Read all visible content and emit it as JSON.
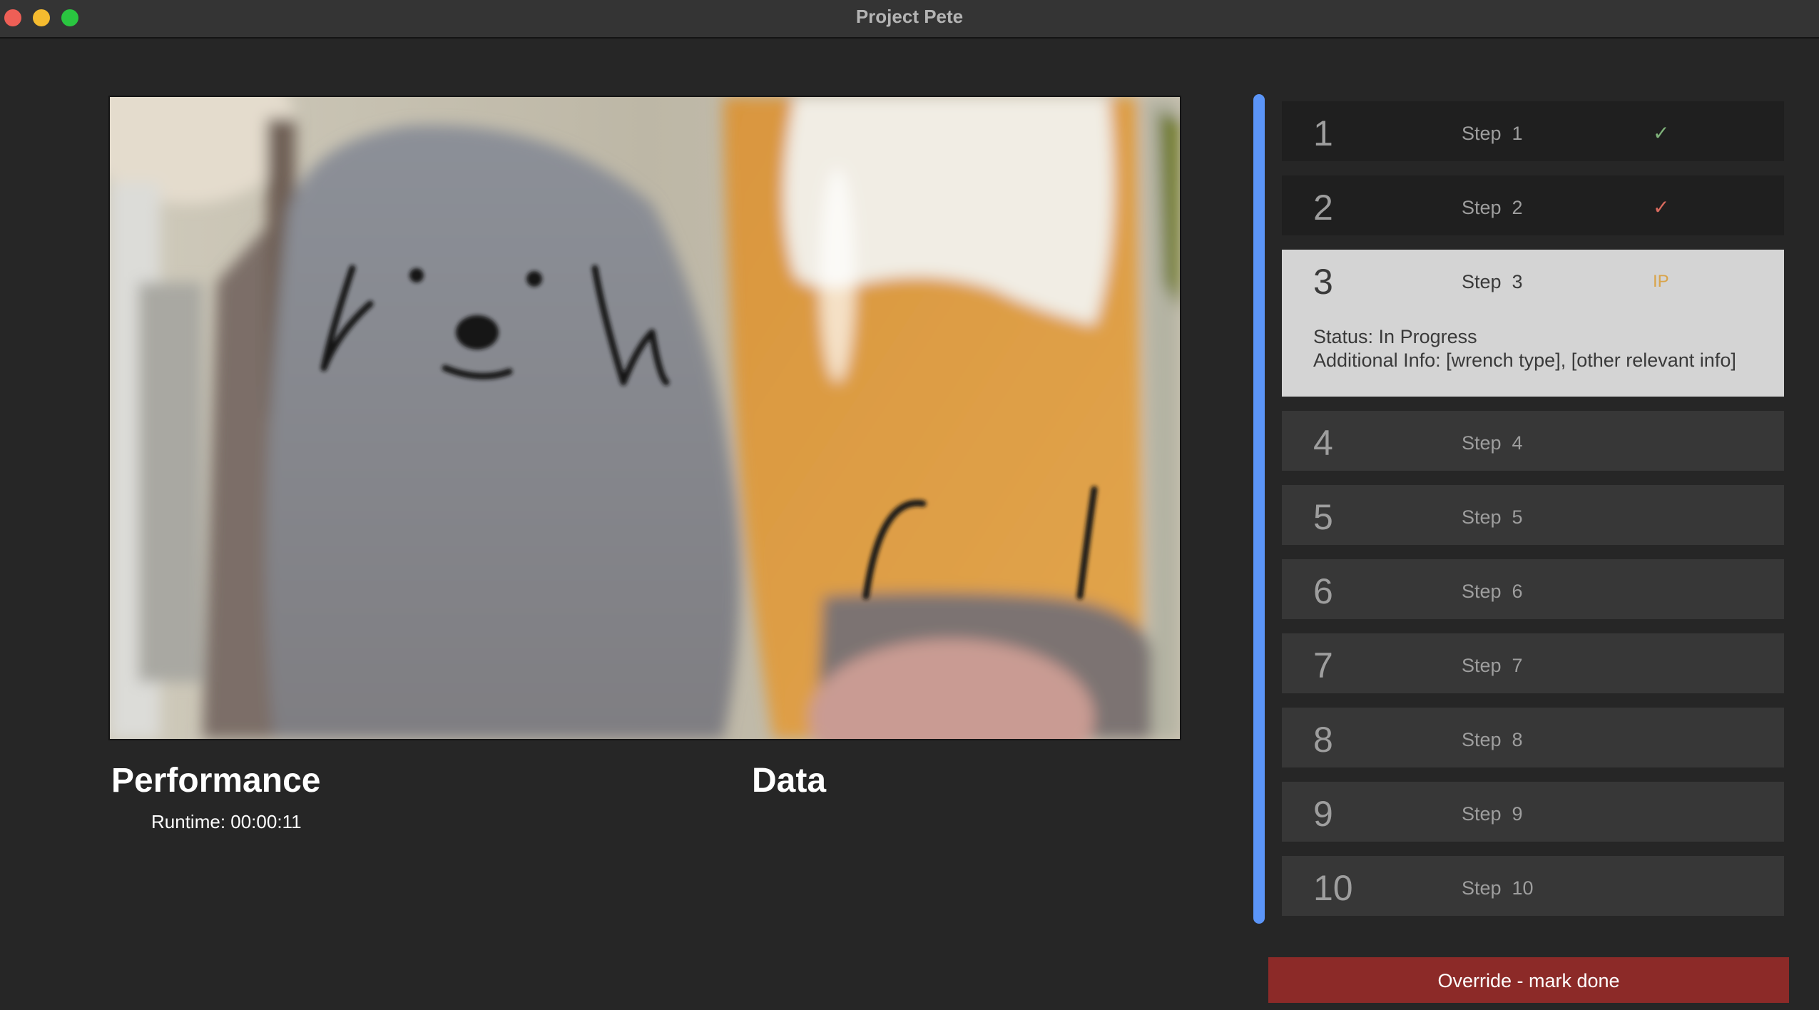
{
  "window": {
    "title": "Project Pete"
  },
  "performance": {
    "title": "Performance",
    "runtime": "Runtime: 00:00:11"
  },
  "data_panel": {
    "title": "Data"
  },
  "steps": [
    {
      "num": "1",
      "label": "Step  1",
      "mark": "✓",
      "state": "done",
      "mark_color": "#7fb27a"
    },
    {
      "num": "2",
      "label": "Step  2",
      "mark": "✓",
      "state": "done",
      "mark_color": "#d86a5e"
    },
    {
      "num": "3",
      "label": "Step  3",
      "mark": "IP",
      "state": "in-progress",
      "status": "Status: In Progress",
      "additional": "Additional Info: [wrench type], [other relevant info]"
    },
    {
      "num": "4",
      "label": "Step  4"
    },
    {
      "num": "5",
      "label": "Step  5"
    },
    {
      "num": "6",
      "label": "Step  6"
    },
    {
      "num": "7",
      "label": "Step  7"
    },
    {
      "num": "8",
      "label": "Step  8"
    },
    {
      "num": "9",
      "label": "Step  9"
    },
    {
      "num": "10",
      "label": "Step  10"
    }
  ],
  "override_button": {
    "label": "Override - mark done"
  },
  "colors": {
    "background": "#262626",
    "override": "#8c2a28",
    "scroll_accent": "#5b95f8",
    "current_step": "#d4d4d4"
  }
}
